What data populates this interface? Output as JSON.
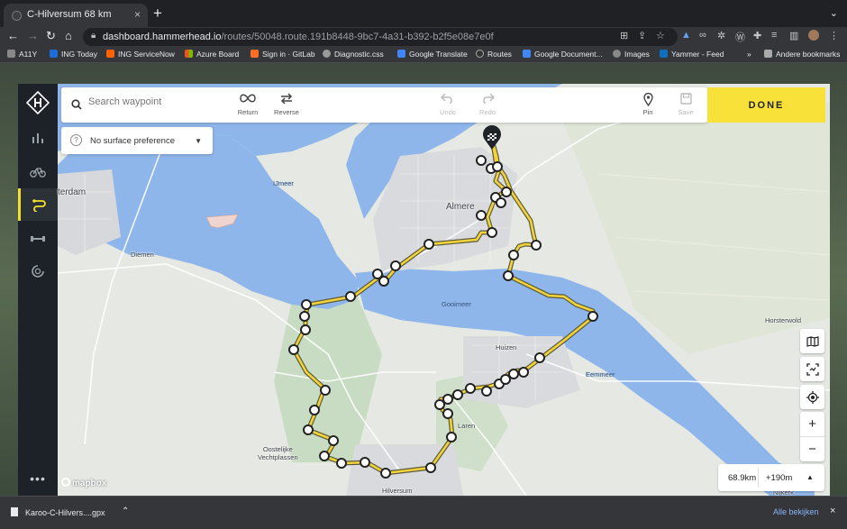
{
  "browser": {
    "tab_title": "C-Hilversum 68 km",
    "new_tab": "+",
    "url_domain": "dashboard.hammerhead.io",
    "url_path": "/routes/50048.route.191b8448-9bc7-4a31-b392-b2f5e08e7e0f",
    "bookmarks": [
      "A11Y",
      "ING Today",
      "ING ServiceNow",
      "Azure Board",
      "Sign in · GitLab",
      "Diagnostic.css",
      "Google Translate",
      "Routes",
      "Google Document...",
      "Images",
      "Yammer - Feed"
    ],
    "bookmarks_overflow": "»",
    "other_bookmarks": "Andere bookmarks"
  },
  "toolbar": {
    "search_placeholder": "Search waypoint",
    "return_label": "Return",
    "reverse_label": "Reverse",
    "undo_label": "Undo",
    "redo_label": "Redo",
    "pin_label": "Pin",
    "save_label": "Save",
    "done_label": "DONE"
  },
  "surface": {
    "selected": "No surface preference"
  },
  "stats": {
    "distance": "68.9km",
    "elevation": "+190m"
  },
  "map": {
    "attribution": "mapbox",
    "labels": {
      "ijmeer": "IJmeer",
      "amsterdam": "terdam",
      "almere": "Almere",
      "diemen": "Diemen",
      "gooimeer": "Gooimeer",
      "huizen": "Huizen",
      "eemmeer": "Eemmeer",
      "laren": "Laren",
      "hilversum": "Hilversum",
      "vechtplassen": "Oostelijke\nVechtplassen",
      "horsterwold": "Horsterwold",
      "nijkerk": "Nijkerk"
    }
  },
  "downloads": {
    "file": "Karoo-C-Hilvers....gpx",
    "show_all": "Alle bekijken"
  },
  "colors": {
    "accent": "#f8e23a",
    "sidebar": "#1c2227",
    "water": "#8fb6ea",
    "land": "#e6e9e3"
  }
}
